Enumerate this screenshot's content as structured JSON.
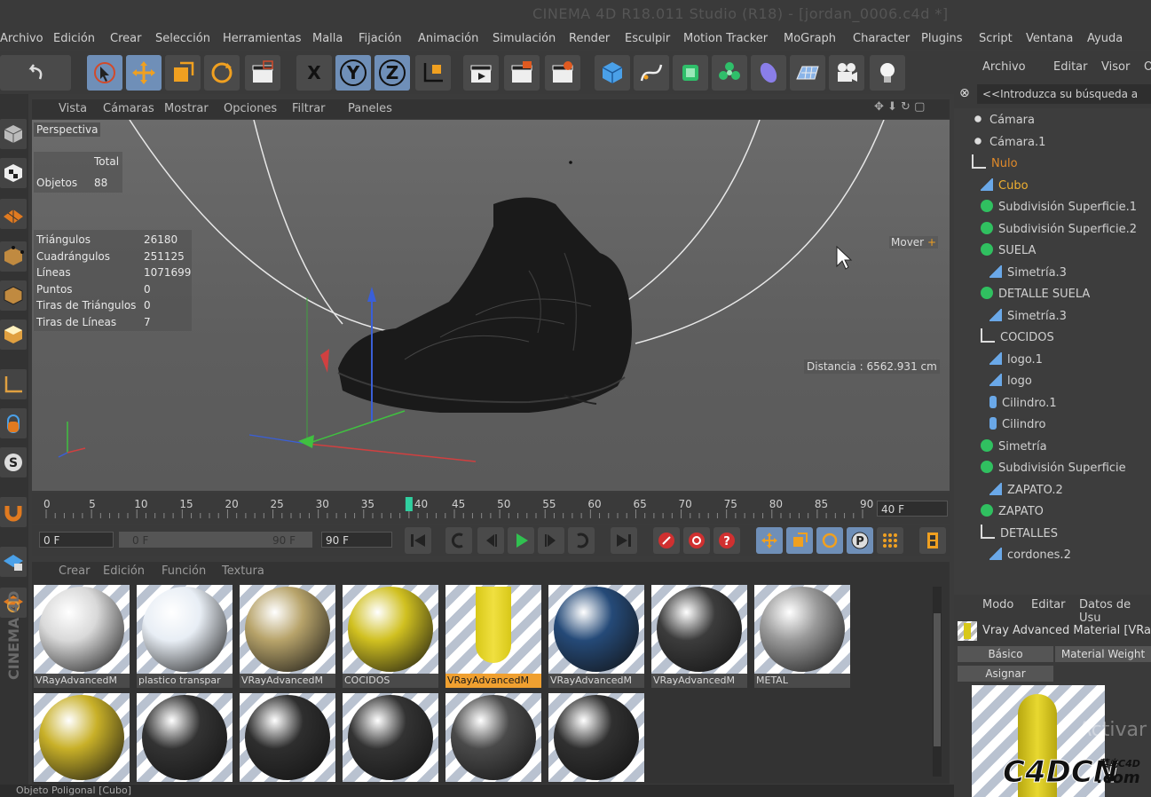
{
  "window": {
    "title": "CINEMA 4D R18.011 Studio (R18) - [jordan_0006.c4d *]"
  },
  "menu": [
    "Archivo",
    "Edición",
    "Crear",
    "Selección",
    "Herramientas",
    "Malla",
    "Fijación",
    "Animación",
    "Simulación",
    "Render",
    "Esculpir",
    "Motion Tracker",
    "MoGraph",
    "Character",
    "Plugins",
    "Script",
    "Ventana",
    "Ayuda"
  ],
  "toolbar": {
    "undo": "undo-icon",
    "axis_x": "X",
    "axis_y": "Y",
    "axis_z": "Z"
  },
  "viewport": {
    "menu": [
      "Vista",
      "Cámaras",
      "Mostrar",
      "Opciones",
      "Filtrar",
      "Paneles"
    ],
    "label": "Perspectiva",
    "stats_header": "Total",
    "objects_label": "Objetos",
    "objects_value": "88",
    "stats": [
      {
        "label": "Triángulos",
        "value": "26180"
      },
      {
        "label": "Cuadrángulos",
        "value": "251125"
      },
      {
        "label": "Líneas",
        "value": "1071699"
      },
      {
        "label": "Puntos",
        "value": "0"
      },
      {
        "label": "Tiras de Triángulos",
        "value": "0"
      },
      {
        "label": "Tiras de Líneas",
        "value": "7"
      }
    ],
    "move_label": "Mover",
    "distance": "Distancia : 6562.931 cm"
  },
  "timeline": {
    "ticks": [
      "0",
      "5",
      "10",
      "15",
      "20",
      "25",
      "30",
      "35",
      "40",
      "45",
      "50",
      "55",
      "60",
      "65",
      "70",
      "75",
      "80",
      "85",
      "90"
    ],
    "current": "40",
    "current_field": "40 F"
  },
  "controls": {
    "start": "0 F",
    "range_start": "0 F",
    "range_end": "90 F",
    "end": "90 F"
  },
  "materials": {
    "menu": [
      "Crear",
      "Edición",
      "Función",
      "Textura"
    ],
    "row1": [
      {
        "label": "VRayAdvancedM",
        "color": "#d9d9d9"
      },
      {
        "label": "plastico transpar",
        "color": "#e8eef5"
      },
      {
        "label": "VRayAdvancedM",
        "color": "#b7a36a"
      },
      {
        "label": "COCIDOS",
        "color": "#d0c020"
      },
      {
        "label": "VRayAdvancedM",
        "color": "#d8c818"
      },
      {
        "label": "VRayAdvancedM",
        "color": "#254a78"
      },
      {
        "label": "VRayAdvancedM",
        "color": "#3c3c3c"
      },
      {
        "label": "METAL",
        "color": "#9a9a9a"
      }
    ],
    "row2": [
      "#c8b028",
      "#333333",
      "#2e2e2e",
      "#333333",
      "#4a4a4a",
      "#303030"
    ]
  },
  "status": "Objeto Poligonal [Cubo]",
  "objects_panel": {
    "menu": [
      "Archivo",
      "Editar",
      "Visor",
      "Obj"
    ],
    "search_placeholder": "<<Introduzca su búsqueda a",
    "items": [
      {
        "label": "Cámara",
        "indent": 0,
        "icon": "camera-icon",
        "color": "#d0d0d0"
      },
      {
        "label": "Cámara.1",
        "indent": 0,
        "icon": "camera-icon",
        "color": "#d0d0d0"
      },
      {
        "label": "Nulo",
        "indent": 0,
        "icon": "null-icon",
        "color": "#e08a2a"
      },
      {
        "label": "Cubo",
        "indent": 1,
        "icon": "polygon-icon",
        "color": "#f0b030"
      },
      {
        "label": "Subdivisión Superficie.1",
        "indent": 1,
        "icon": "subdivision-icon",
        "color": "#d0d0d0"
      },
      {
        "label": "Subdivisión Superficie.2",
        "indent": 1,
        "icon": "subdivision-icon",
        "color": "#d0d0d0"
      },
      {
        "label": "SUELA",
        "indent": 1,
        "icon": "subdivision-icon",
        "color": "#d0d0d0"
      },
      {
        "label": "Simetría.3",
        "indent": 2,
        "icon": "polygon-icon",
        "color": "#d0d0d0"
      },
      {
        "label": "DETALLE SUELA",
        "indent": 1,
        "icon": "subdivision-icon",
        "color": "#d0d0d0"
      },
      {
        "label": "Simetría.3",
        "indent": 2,
        "icon": "polygon-icon",
        "color": "#d0d0d0"
      },
      {
        "label": "COCIDOS",
        "indent": 1,
        "icon": "null-icon",
        "color": "#d0d0d0"
      },
      {
        "label": "logo.1",
        "indent": 2,
        "icon": "polygon-icon",
        "color": "#d0d0d0"
      },
      {
        "label": "logo",
        "indent": 2,
        "icon": "polygon-icon",
        "color": "#d0d0d0"
      },
      {
        "label": "Cilindro.1",
        "indent": 2,
        "icon": "cylinder-icon",
        "color": "#d0d0d0"
      },
      {
        "label": "Cilindro",
        "indent": 2,
        "icon": "cylinder-icon",
        "color": "#d0d0d0"
      },
      {
        "label": "Simetría",
        "indent": 1,
        "icon": "symmetry-icon",
        "color": "#d0d0d0"
      },
      {
        "label": "Subdivisión Superficie",
        "indent": 1,
        "icon": "subdivision-icon",
        "color": "#d0d0d0"
      },
      {
        "label": "ZAPATO.2",
        "indent": 2,
        "icon": "polygon-icon",
        "color": "#d0d0d0"
      },
      {
        "label": "ZAPATO",
        "indent": 1,
        "icon": "subdivision-icon",
        "color": "#d0d0d0"
      },
      {
        "label": "DETALLES",
        "indent": 1,
        "icon": "null-icon",
        "color": "#d0d0d0"
      },
      {
        "label": "cordones.2",
        "indent": 2,
        "icon": "polygon-icon",
        "color": "#d0d0d0"
      }
    ]
  },
  "attributes": {
    "menu": [
      "Modo",
      "Editar",
      "Datos de Usu"
    ],
    "material_name": "Vray Advanced Material [VRay",
    "tab_basic": "Básico",
    "tab_weight": "Material Weight",
    "tab_assign": "Asignar"
  },
  "watermark": {
    "activate": "Activar",
    "brand": "C4DCN",
    "brand_cn": "菜鸟C4D",
    "brand_domain": ".com"
  }
}
